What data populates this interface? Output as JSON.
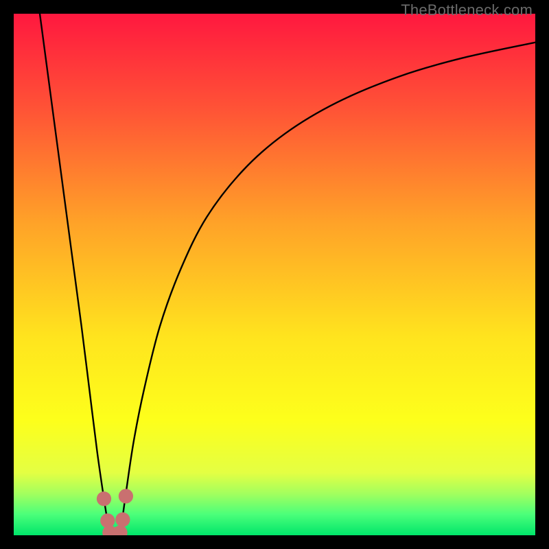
{
  "watermark": "TheBottleneck.com",
  "chart_data": {
    "type": "line",
    "title": "",
    "xlabel": "",
    "ylabel": "",
    "xlim": [
      0,
      100
    ],
    "ylim": [
      0,
      100
    ],
    "grid": false,
    "legend": false,
    "gradient_stops": [
      {
        "pos": 0.0,
        "color": "#ff183f"
      },
      {
        "pos": 0.18,
        "color": "#ff5236"
      },
      {
        "pos": 0.4,
        "color": "#ffa228"
      },
      {
        "pos": 0.62,
        "color": "#ffe41e"
      },
      {
        "pos": 0.78,
        "color": "#fdff1b"
      },
      {
        "pos": 0.88,
        "color": "#e4ff43"
      },
      {
        "pos": 0.92,
        "color": "#a3ff5e"
      },
      {
        "pos": 0.96,
        "color": "#4bff7a"
      },
      {
        "pos": 1.0,
        "color": "#00e56a"
      }
    ],
    "series": [
      {
        "name": "left-branch",
        "x": [
          5.0,
          7.0,
          9.0,
          11.0,
          13.0,
          14.5,
          16.0,
          17.3,
          18.4
        ],
        "y": [
          100.0,
          85.0,
          70.0,
          55.0,
          40.0,
          28.0,
          16.0,
          7.0,
          0.0
        ]
      },
      {
        "name": "right-branch",
        "x": [
          20.4,
          21.5,
          23.0,
          25.0,
          28.0,
          32.0,
          37.0,
          44.0,
          52.0,
          62.0,
          74.0,
          86.0,
          100.0
        ],
        "y": [
          0.0,
          8.0,
          18.0,
          28.0,
          40.0,
          51.0,
          61.0,
          70.0,
          77.0,
          83.0,
          88.0,
          91.5,
          94.5
        ]
      }
    ],
    "markers": [
      {
        "x": 17.3,
        "y": 7.0,
        "r": 1.4,
        "color": "#c97070"
      },
      {
        "x": 18.0,
        "y": 2.8,
        "r": 1.4,
        "color": "#c97070"
      },
      {
        "x": 18.4,
        "y": 0.5,
        "r": 1.4,
        "color": "#c97070"
      },
      {
        "x": 20.4,
        "y": 0.5,
        "r": 1.4,
        "color": "#c97070"
      },
      {
        "x": 20.9,
        "y": 3.0,
        "r": 1.4,
        "color": "#c97070"
      },
      {
        "x": 21.5,
        "y": 7.5,
        "r": 1.4,
        "color": "#c97070"
      }
    ],
    "notch_center_x": 19.4
  }
}
